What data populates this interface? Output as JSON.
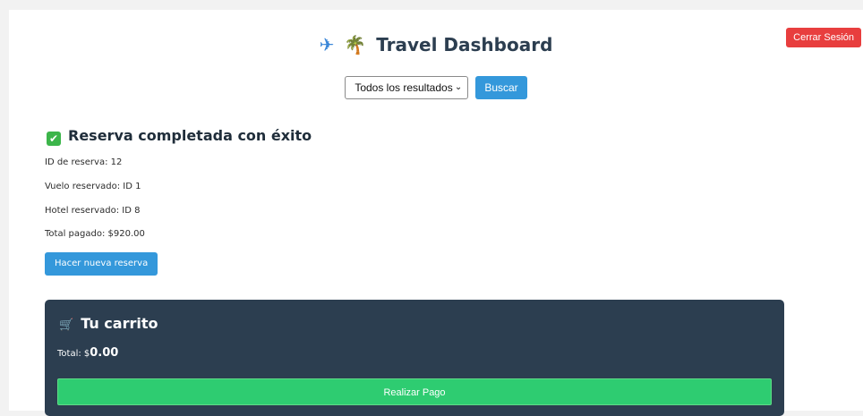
{
  "header": {
    "title": "Travel Dashboard",
    "plane_icon": "✈",
    "palm_icon": "🌴",
    "logout_label": "Cerrar Sesión"
  },
  "search": {
    "selected_option": "Todos los resultados",
    "button_label": "Buscar"
  },
  "reservation": {
    "heading": "Reserva completada con éxito",
    "id_line": "ID de reserva: 12",
    "flight_line": "Vuelo reservado: ID 1",
    "hotel_line": "Hotel reservado: ID 8",
    "total_line": "Total pagado: $920.00",
    "new_button_label": "Hacer nueva reserva"
  },
  "cart": {
    "title": "Tu carrito",
    "total_prefix": "Total: $",
    "total_amount": "0.00",
    "pay_button_label": "Realizar Pago"
  },
  "colors": {
    "logout": "#e83e3e",
    "primary": "#3498db",
    "cart_bg": "#2c3e50",
    "pay": "#2ecc71",
    "success": "#3cb54a"
  }
}
